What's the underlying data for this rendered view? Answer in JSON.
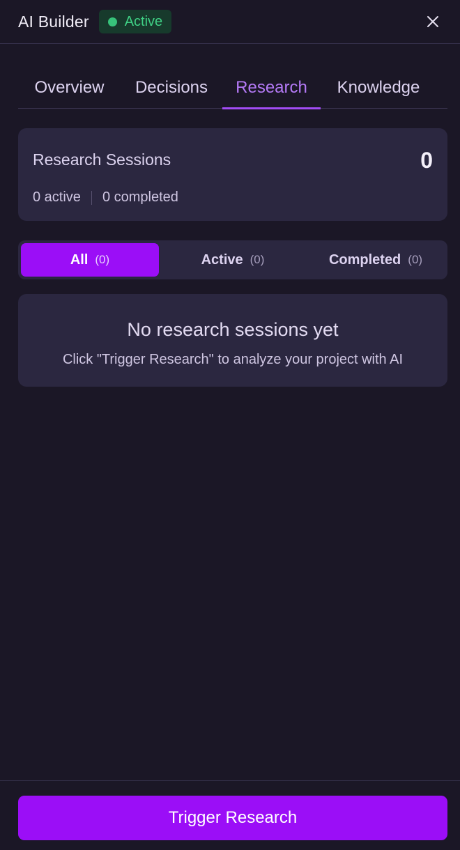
{
  "header": {
    "title": "AI Builder",
    "status": "Active",
    "status_color": "#37c27a",
    "close_icon": "close-icon"
  },
  "tabs": [
    {
      "label": "Overview",
      "active": false
    },
    {
      "label": "Decisions",
      "active": false
    },
    {
      "label": "Research",
      "active": true
    },
    {
      "label": "Knowledge",
      "active": false
    }
  ],
  "summary": {
    "title": "Research Sessions",
    "count": "0",
    "active_text": "0 active",
    "completed_text": "0 completed"
  },
  "filters": [
    {
      "label": "All",
      "count": "(0)",
      "selected": true
    },
    {
      "label": "Active",
      "count": "(0)",
      "selected": false
    },
    {
      "label": "Completed",
      "count": "(0)",
      "selected": false
    }
  ],
  "empty_state": {
    "title": "No research sessions yet",
    "description": "Click \"Trigger Research\" to analyze your project with AI"
  },
  "footer": {
    "button_label": "Trigger Research"
  },
  "colors": {
    "accent": "#9b0ef7",
    "tab_active": "#b57af7",
    "background": "#1b1726",
    "card": "#2b2740"
  }
}
